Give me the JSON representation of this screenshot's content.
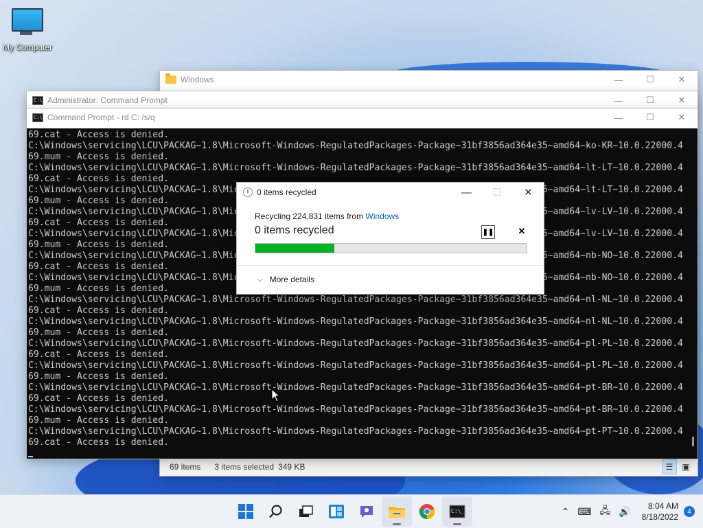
{
  "desktop": {
    "icon_label": "My Computer"
  },
  "explorer": {
    "title": "Windows",
    "status": {
      "items": "69 items",
      "selected": "3 items selected",
      "size": "349 KB"
    }
  },
  "admin_cmd": {
    "title": "Administrator: Command Prompt"
  },
  "cmd": {
    "title": "Command Prompt - rd  C: /s/q",
    "lines": [
      "69.cat - Access is denied.",
      "C:\\Windows\\servicing\\LCU\\PACKAG~1.8\\Microsoft-Windows-RegulatedPackages-Package~31bf3856ad364e35~amd64~ko-KR~10.0.22000.4",
      "69.mum - Access is denied.",
      "C:\\Windows\\servicing\\LCU\\PACKAG~1.8\\Microsoft-Windows-RegulatedPackages-Package~31bf3856ad364e35~amd64~lt-LT~10.0.22000.4",
      "69.cat - Access is denied.",
      "C:\\Windows\\servicing\\LCU\\PACKAG~1.8\\Microsoft-Windows-RegulatedPackages-Package~31bf3856ad364e35~amd64~lt-LT~10.0.22000.4",
      "69.mum - Access is denied.",
      "C:\\Windows\\servicing\\LCU\\PACKAG~1.8\\Microsoft-Windows-RegulatedPackages-Package~31bf3856ad364e35~amd64~lv-LV~10.0.22000.4",
      "69.cat - Access is denied.",
      "C:\\Windows\\servicing\\LCU\\PACKAG~1.8\\Microsoft-Windows-RegulatedPackages-Package~31bf3856ad364e35~amd64~lv-LV~10.0.22000.4",
      "69.mum - Access is denied.",
      "C:\\Windows\\servicing\\LCU\\PACKAG~1.8\\Microsoft-Windows-RegulatedPackages-Package~31bf3856ad364e35~amd64~nb-NO~10.0.22000.4",
      "69.cat - Access is denied.",
      "C:\\Windows\\servicing\\LCU\\PACKAG~1.8\\Microsoft-Windows-RegulatedPackages-Package~31bf3856ad364e35~amd64~nb-NO~10.0.22000.4",
      "69.mum - Access is denied.",
      "C:\\Windows\\servicing\\LCU\\PACKAG~1.8\\Microsoft-Windows-RegulatedPackages-Package~31bf3856ad364e35~amd64~nl-NL~10.0.22000.4",
      "69.cat - Access is denied.",
      "C:\\Windows\\servicing\\LCU\\PACKAG~1.8\\Microsoft-Windows-RegulatedPackages-Package~31bf3856ad364e35~amd64~nl-NL~10.0.22000.4",
      "69.mum - Access is denied.",
      "C:\\Windows\\servicing\\LCU\\PACKAG~1.8\\Microsoft-Windows-RegulatedPackages-Package~31bf3856ad364e35~amd64~pl-PL~10.0.22000.4",
      "69.cat - Access is denied.",
      "C:\\Windows\\servicing\\LCU\\PACKAG~1.8\\Microsoft-Windows-RegulatedPackages-Package~31bf3856ad364e35~amd64~pl-PL~10.0.22000.4",
      "69.mum - Access is denied.",
      "C:\\Windows\\servicing\\LCU\\PACKAG~1.8\\Microsoft-Windows-RegulatedPackages-Package~31bf3856ad364e35~amd64~pt-BR~10.0.22000.4",
      "69.cat - Access is denied.",
      "C:\\Windows\\servicing\\LCU\\PACKAG~1.8\\Microsoft-Windows-RegulatedPackages-Package~31bf3856ad364e35~amd64~pt-BR~10.0.22000.4",
      "69.mum - Access is denied.",
      "C:\\Windows\\servicing\\LCU\\PACKAG~1.8\\Microsoft-Windows-RegulatedPackages-Package~31bf3856ad364e35~amd64~pt-PT~10.0.22000.4",
      "69.cat - Access is denied."
    ]
  },
  "dialog": {
    "title": "0 items recycled",
    "recycling_prefix": "Recycling 224,831 items from",
    "source_link": "Windows",
    "status": "0 items recycled",
    "progress_percent": 29,
    "more_details": "More details",
    "progress_color": "#06b025"
  },
  "taskbar": {
    "apps": [
      "start-icon",
      "search-icon",
      "task-view-icon",
      "widgets-icon",
      "chat-icon",
      "file-explorer-icon",
      "chrome-icon",
      "terminal-icon"
    ],
    "time": "8:04 AM",
    "date": "8/18/2022",
    "notification_count": "4"
  }
}
